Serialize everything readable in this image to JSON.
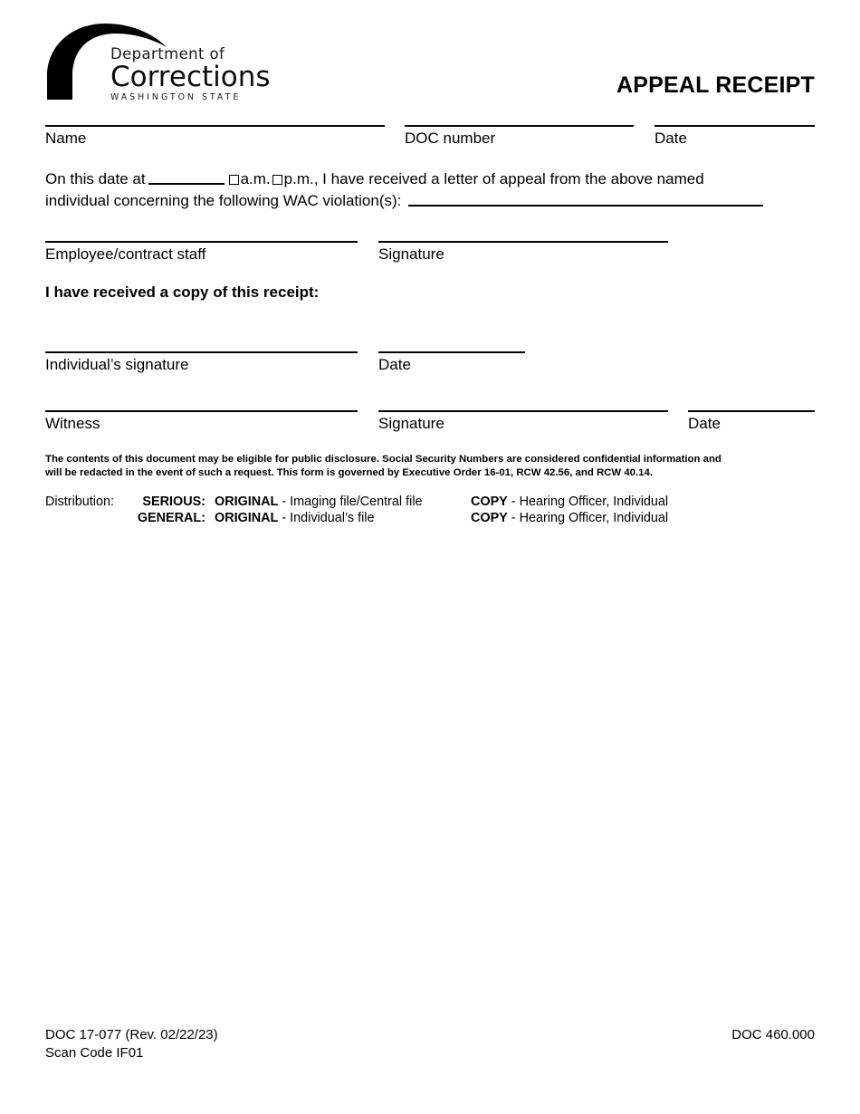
{
  "header": {
    "logo": {
      "line1": "Department of",
      "line2": "Corrections",
      "line3": "WASHINGTON STATE",
      "mark": "arc-swoosh"
    },
    "title": "APPEAL RECEIPT"
  },
  "fields": {
    "name": "Name",
    "doc_number": "DOC number",
    "date_top": "Date",
    "employee": "Employee/contract staff",
    "signature_employee": "Signature",
    "individual_signature": "Individual’s signature",
    "date_individual": "Date",
    "witness": "Witness",
    "signature_witness": "Signature",
    "date_witness": "Date"
  },
  "paragraph": {
    "seg1": "On this date at",
    "time_blank": "",
    "am_label": "a.m.",
    "pm_label": "p.m.,",
    "seg2": "I have received a letter of appeal from the above named",
    "line2_start": "individual concerning the following WAC violation(s):",
    "wac_blank": ""
  },
  "acknowledgement": "I have received a copy of this receipt:",
  "fineprint": {
    "line1": "The contents of this document may be eligible for public disclosure.  Social Security Numbers are considered confidential information and",
    "line2": "will be redacted in the event of such a request.  This form is governed by Executive Order 16-01, RCW 42.56, and RCW 40.14."
  },
  "distribution": {
    "label": "Distribution:",
    "rows": [
      {
        "type": "SERIOUS:",
        "original_bold": "ORIGINAL",
        "original_rest": " - Imaging file/Central file",
        "copy_bold": "COPY",
        "copy_rest": " - Hearing Officer, Individual"
      },
      {
        "type": "GENERAL:",
        "original_bold": "ORIGINAL",
        "original_rest": " - Individual’s file",
        "copy_bold": "COPY",
        "copy_rest": " - Hearing Officer, Individual"
      }
    ]
  },
  "footer": {
    "form_number": "DOC 17-077 (Rev. 02/22/23)",
    "scan_code": "Scan Code IF01",
    "policy_number": "DOC 460.000"
  },
  "colors": {
    "ink": "#000000",
    "paper": "#ffffff"
  }
}
